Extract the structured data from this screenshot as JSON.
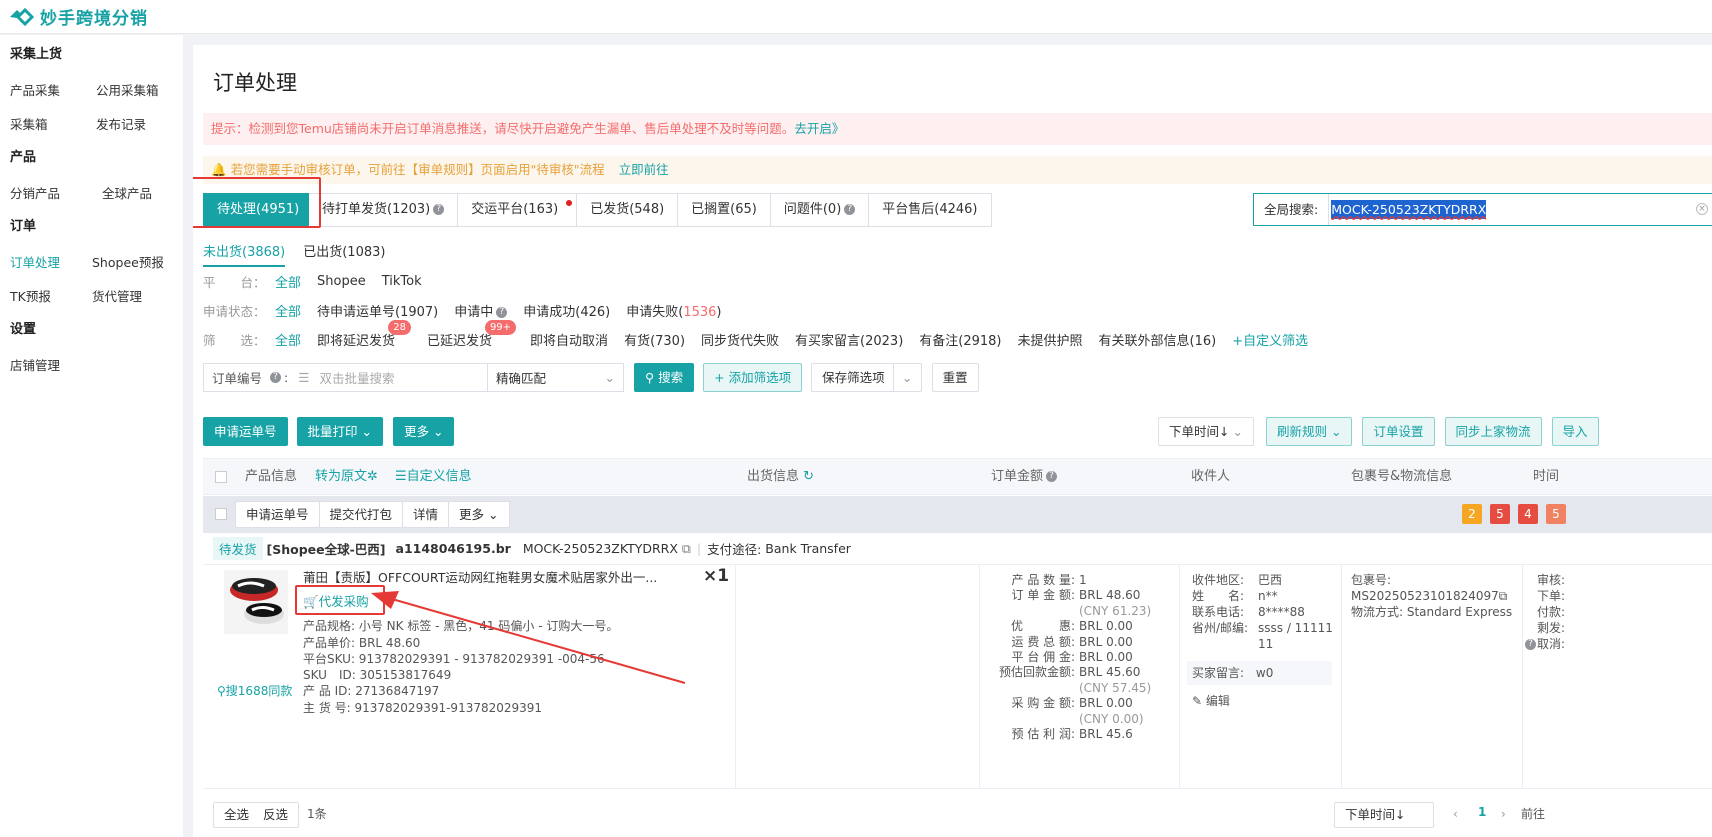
{
  "app": {
    "name": "妙手跨境分销"
  },
  "sidebar": {
    "groups": [
      {
        "title": "采集上货",
        "rows": [
          [
            "产品采集",
            "公用采集箱"
          ],
          [
            "采集箱",
            "发布记录"
          ]
        ]
      },
      {
        "title": "产品",
        "rows": [
          [
            "分销产品",
            "全球产品"
          ]
        ]
      },
      {
        "title": "订单",
        "rows": [
          [
            "订单处理",
            "Shopee预报"
          ],
          [
            "TK预报",
            "货代管理"
          ]
        ]
      },
      {
        "title": "设置",
        "rows": [
          [
            "店铺管理"
          ]
        ]
      }
    ]
  },
  "page": {
    "title": "订单处理"
  },
  "alerts": {
    "red_text": "提示：检测到您Temu店铺尚未开启订单消息推送，请尽快开启避免产生漏单、售后单处理不及时等问题。",
    "red_link": "去开启》",
    "orange_text": "若您需要手动审核订单，可前往【审单规则】页面启用\"待审核\"流程",
    "orange_link": "立即前往"
  },
  "tabs": [
    "待处理(4951)",
    "待打单发货(1203)",
    "交运平台(163)",
    "已发货(548)",
    "已搁置(65)",
    "问题件(0)",
    "平台售后(4246)"
  ],
  "global_search": {
    "label": "全局搜索:",
    "value": "MOCK-250523ZKTYDRRX"
  },
  "subtabs": [
    "未出货(3868)",
    "已出货(1083)"
  ],
  "filters": {
    "platform": {
      "label": "平　　台：",
      "options": [
        "全部",
        "Shopee",
        "TikTok"
      ]
    },
    "apply_status": {
      "label": "申请状态：",
      "options": [
        "全部",
        "待申请运单号(1907)",
        "申请中",
        "申请成功(426)",
        "申请失败("
      ],
      "fail_count": "1536",
      "close_paren": ")"
    },
    "screen": {
      "label": "筛　　选：",
      "options": [
        "全部",
        "即将延迟发货",
        "已延迟发货",
        "即将自动取消",
        "有货(730)",
        "同步货代失败",
        "有买家留言(2023)",
        "有备注(2918)",
        "未提供护照",
        "有关联外部信息(16)"
      ],
      "badge1": "28",
      "badge2": "99+",
      "custom": "+自定义筛选"
    }
  },
  "search_bar": {
    "field": "订单编号",
    "placeholder": "双击批量搜索",
    "match": "精确匹配",
    "search_btn": "搜索",
    "add_filter": "+ 添加筛选项",
    "save_filter": "保存筛选项",
    "reset": "重置"
  },
  "actions": {
    "apply_waybill": "申请运单号",
    "batch_print": "批量打印",
    "more": "更多"
  },
  "right_actions": {
    "sort": "下单时间↓",
    "refresh_rule": "刷新规则",
    "order_settings": "订单设置",
    "sync_logistics": "同步上家物流",
    "import": "导入"
  },
  "table_head": {
    "product_info": "产品信息",
    "to_original": "转为原文",
    "custom_info": "自定义信息",
    "ship_info": "出货信息",
    "amount": "订单金额",
    "receiver": "收件人",
    "package": "包裹号&物流信息",
    "time": "时间"
  },
  "batch": {
    "buttons": [
      "申请运单号",
      "提交代打包",
      "详情",
      "更多"
    ],
    "counts": [
      "2",
      "5",
      "4",
      "5"
    ],
    "colors": [
      "#f5a623",
      "#e54d42",
      "#e54d42",
      "#f08262"
    ]
  },
  "order": {
    "status": "待发货",
    "store": "[Shopee全球-巴西]",
    "account": "a1148046195.br",
    "order_no": "MOCK-250523ZKTYDRRX",
    "pay_label": "支付途径:",
    "pay_value": "Bank Transfer",
    "product_title": "莆田【责版】OFFCOURT运动网红拖鞋男女魔术贴居家外出一...",
    "qty": "×1",
    "purchase": "代发采购",
    "search_1688": "搜1688同款",
    "spec": "产品规格:  小号 NK 标签 - 黑色，41 码偏小 - 订购大一号。",
    "unit_price": "产品单价:  BRL 48.60",
    "platform_sku": "平台SKU:  913782029391 - 913782029391 -004-56",
    "sku_id": "SKU　ID:  305153817649",
    "product_id": "产 品 ID:  27136847197",
    "main_no": "主 货 号:  913782029391-913782029391",
    "amounts": [
      [
        "产 品 数 量:",
        "1"
      ],
      [
        "订 单 金 额:",
        "BRL 48.60"
      ],
      [
        "",
        "(CNY 61.23)"
      ],
      [
        "优　　　惠:",
        "BRL 0.00"
      ],
      [
        "运 费 总 额:",
        "BRL 0.00"
      ],
      [
        "平 台 佣 金:",
        "BRL 0.00"
      ],
      [
        "预估回款金额:",
        "BRL 45.60"
      ],
      [
        "",
        "(CNY 57.45)"
      ],
      [
        "采 购 金 额:",
        "BRL 0.00"
      ],
      [
        "",
        "(CNY 0.00)"
      ],
      [
        "预 估 利 润:",
        "BRL 45.6"
      ]
    ],
    "receiver": [
      [
        "收件地区:",
        "巴西"
      ],
      [
        "姓　　名:",
        "n**"
      ],
      [
        "联系电话:",
        "8****88"
      ],
      [
        "省州/邮编:",
        "ssss / 11111"
      ],
      [
        "",
        "11"
      ]
    ],
    "buyer_msg": [
      "买家留言:",
      "w0"
    ],
    "edit": "编辑",
    "package_label": "包裹号:",
    "package_no": "MS20250523101824097",
    "logistics": "物流方式:  Standard Express",
    "time_labels": [
      "审核:",
      "下单:",
      "付款:",
      "剩发:",
      "取消:"
    ]
  },
  "footer": {
    "select_all": "全选",
    "invert": "反选",
    "count": "1条",
    "sort": "下单时间↓",
    "page": "1",
    "goto": "前往"
  }
}
